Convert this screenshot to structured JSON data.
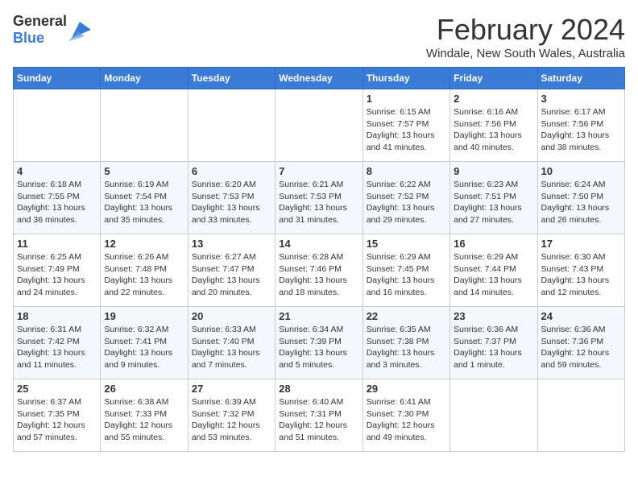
{
  "header": {
    "logo_general": "General",
    "logo_blue": "Blue",
    "month_year": "February 2024",
    "location": "Windale, New South Wales, Australia"
  },
  "calendar": {
    "days_of_week": [
      "Sunday",
      "Monday",
      "Tuesday",
      "Wednesday",
      "Thursday",
      "Friday",
      "Saturday"
    ],
    "weeks": [
      [
        {
          "day": "",
          "info": ""
        },
        {
          "day": "",
          "info": ""
        },
        {
          "day": "",
          "info": ""
        },
        {
          "day": "",
          "info": ""
        },
        {
          "day": "1",
          "info": "Sunrise: 6:15 AM\nSunset: 7:57 PM\nDaylight: 13 hours\nand 41 minutes."
        },
        {
          "day": "2",
          "info": "Sunrise: 6:16 AM\nSunset: 7:56 PM\nDaylight: 13 hours\nand 40 minutes."
        },
        {
          "day": "3",
          "info": "Sunrise: 6:17 AM\nSunset: 7:56 PM\nDaylight: 13 hours\nand 38 minutes."
        }
      ],
      [
        {
          "day": "4",
          "info": "Sunrise: 6:18 AM\nSunset: 7:55 PM\nDaylight: 13 hours\nand 36 minutes."
        },
        {
          "day": "5",
          "info": "Sunrise: 6:19 AM\nSunset: 7:54 PM\nDaylight: 13 hours\nand 35 minutes."
        },
        {
          "day": "6",
          "info": "Sunrise: 6:20 AM\nSunset: 7:53 PM\nDaylight: 13 hours\nand 33 minutes."
        },
        {
          "day": "7",
          "info": "Sunrise: 6:21 AM\nSunset: 7:53 PM\nDaylight: 13 hours\nand 31 minutes."
        },
        {
          "day": "8",
          "info": "Sunrise: 6:22 AM\nSunset: 7:52 PM\nDaylight: 13 hours\nand 29 minutes."
        },
        {
          "day": "9",
          "info": "Sunrise: 6:23 AM\nSunset: 7:51 PM\nDaylight: 13 hours\nand 27 minutes."
        },
        {
          "day": "10",
          "info": "Sunrise: 6:24 AM\nSunset: 7:50 PM\nDaylight: 13 hours\nand 26 minutes."
        }
      ],
      [
        {
          "day": "11",
          "info": "Sunrise: 6:25 AM\nSunset: 7:49 PM\nDaylight: 13 hours\nand 24 minutes."
        },
        {
          "day": "12",
          "info": "Sunrise: 6:26 AM\nSunset: 7:48 PM\nDaylight: 13 hours\nand 22 minutes."
        },
        {
          "day": "13",
          "info": "Sunrise: 6:27 AM\nSunset: 7:47 PM\nDaylight: 13 hours\nand 20 minutes."
        },
        {
          "day": "14",
          "info": "Sunrise: 6:28 AM\nSunset: 7:46 PM\nDaylight: 13 hours\nand 18 minutes."
        },
        {
          "day": "15",
          "info": "Sunrise: 6:29 AM\nSunset: 7:45 PM\nDaylight: 13 hours\nand 16 minutes."
        },
        {
          "day": "16",
          "info": "Sunrise: 6:29 AM\nSunset: 7:44 PM\nDaylight: 13 hours\nand 14 minutes."
        },
        {
          "day": "17",
          "info": "Sunrise: 6:30 AM\nSunset: 7:43 PM\nDaylight: 13 hours\nand 12 minutes."
        }
      ],
      [
        {
          "day": "18",
          "info": "Sunrise: 6:31 AM\nSunset: 7:42 PM\nDaylight: 13 hours\nand 11 minutes."
        },
        {
          "day": "19",
          "info": "Sunrise: 6:32 AM\nSunset: 7:41 PM\nDaylight: 13 hours\nand 9 minutes."
        },
        {
          "day": "20",
          "info": "Sunrise: 6:33 AM\nSunset: 7:40 PM\nDaylight: 13 hours\nand 7 minutes."
        },
        {
          "day": "21",
          "info": "Sunrise: 6:34 AM\nSunset: 7:39 PM\nDaylight: 13 hours\nand 5 minutes."
        },
        {
          "day": "22",
          "info": "Sunrise: 6:35 AM\nSunset: 7:38 PM\nDaylight: 13 hours\nand 3 minutes."
        },
        {
          "day": "23",
          "info": "Sunrise: 6:36 AM\nSunset: 7:37 PM\nDaylight: 13 hours\nand 1 minute."
        },
        {
          "day": "24",
          "info": "Sunrise: 6:36 AM\nSunset: 7:36 PM\nDaylight: 12 hours\nand 59 minutes."
        }
      ],
      [
        {
          "day": "25",
          "info": "Sunrise: 6:37 AM\nSunset: 7:35 PM\nDaylight: 12 hours\nand 57 minutes."
        },
        {
          "day": "26",
          "info": "Sunrise: 6:38 AM\nSunset: 7:33 PM\nDaylight: 12 hours\nand 55 minutes."
        },
        {
          "day": "27",
          "info": "Sunrise: 6:39 AM\nSunset: 7:32 PM\nDaylight: 12 hours\nand 53 minutes."
        },
        {
          "day": "28",
          "info": "Sunrise: 6:40 AM\nSunset: 7:31 PM\nDaylight: 12 hours\nand 51 minutes."
        },
        {
          "day": "29",
          "info": "Sunrise: 6:41 AM\nSunset: 7:30 PM\nDaylight: 12 hours\nand 49 minutes."
        },
        {
          "day": "",
          "info": ""
        },
        {
          "day": "",
          "info": ""
        }
      ]
    ]
  }
}
